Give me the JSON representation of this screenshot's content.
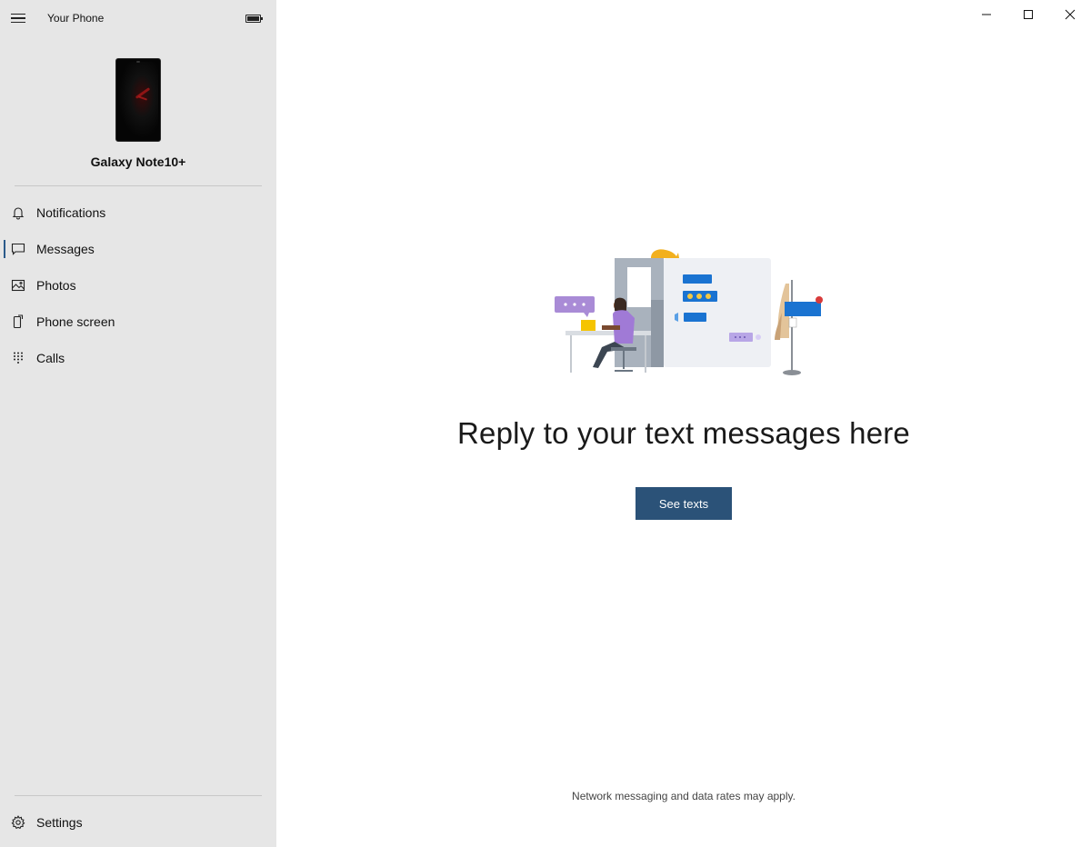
{
  "app": {
    "title": "Your Phone"
  },
  "device": {
    "name": "Galaxy Note10+"
  },
  "sidebar": {
    "items": [
      {
        "label": "Notifications",
        "icon": "bell-icon"
      },
      {
        "label": "Messages",
        "icon": "chat-bubble-icon",
        "selected": true
      },
      {
        "label": "Photos",
        "icon": "image-icon"
      },
      {
        "label": "Phone screen",
        "icon": "phone-screen-icon"
      },
      {
        "label": "Calls",
        "icon": "dialpad-icon"
      }
    ],
    "settings": {
      "label": "Settings",
      "icon": "gear-icon"
    }
  },
  "main": {
    "headline": "Reply to your text messages here",
    "button_label": "See texts",
    "footnote": "Network messaging and data rates may apply."
  },
  "colors": {
    "sidebar_bg": "#e6e6e6",
    "accent": "#2b5278",
    "selection_indicator": "#2b5a8a"
  }
}
